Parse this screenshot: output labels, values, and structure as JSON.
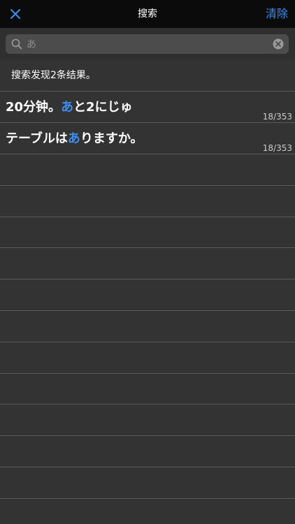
{
  "navbar": {
    "close_icon": "close-x-icon",
    "title": "搜索",
    "clear_label": "清除"
  },
  "search": {
    "value": "あ",
    "search_icon": "magnifier-icon",
    "clear_icon": "clear-circle-x-icon"
  },
  "summary": "搜索发现2条结果。",
  "results": [
    {
      "before": "20分钟。",
      "match": "あ",
      "after": "と2にじゅ",
      "position": "18/353"
    },
    {
      "before": "テーブルは",
      "match": "あ",
      "after": "りますか。",
      "position": "18/353"
    }
  ],
  "colors": {
    "background": "#333333",
    "navbar": "#0b0b0b",
    "accent": "#3d8ef0",
    "divider": "#5a5a5a"
  }
}
